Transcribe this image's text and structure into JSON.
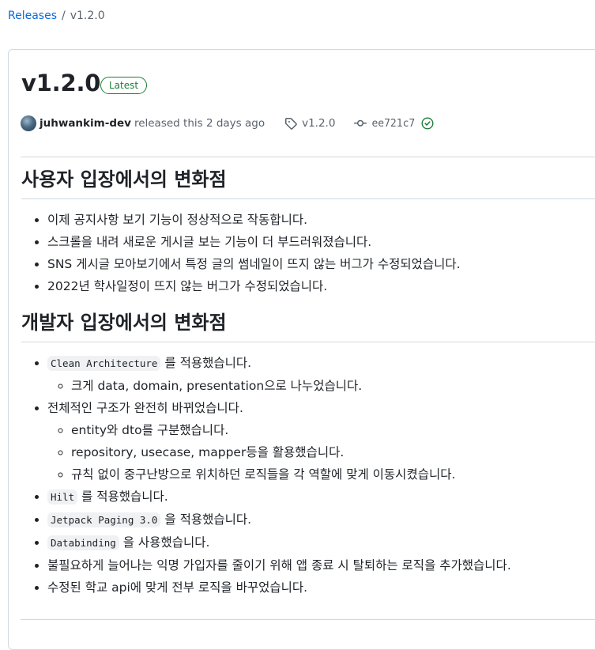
{
  "breadcrumb": {
    "root": "Releases",
    "sep": "/",
    "current": "v1.2.0"
  },
  "release": {
    "title": "v1.2.0",
    "badge": "Latest",
    "author": "juhwankim-dev",
    "released_text": "released this 2 days ago",
    "tag": "v1.2.0",
    "commit": "ee721c7"
  },
  "sections": [
    {
      "heading": "사용자 입장에서의 변화점",
      "items": [
        "이제 공지사항 보기 기능이 정상적으로 작동합니다.",
        "스크롤을 내려 새로운 게시글 보는 기능이 더 부드러워졌습니다.",
        "SNS 게시글 모아보기에서 특정 글의 썸네일이 뜨지 않는 버그가 수정되었습니다.",
        "2022년 학사일정이 뜨지 않는 버그가 수정되었습니다."
      ]
    },
    {
      "heading": "개발자 입장에서의 변화점",
      "items": [
        {
          "code": "Clean Architecture",
          "text": "를 적용했습니다."
        },
        {
          "sub": "크게 data, domain, presentation으로 나누었습니다."
        },
        {
          "text": "전체적인 구조가 완전히 바뀌었습니다."
        },
        {
          "sub": "entity와 dto를 구분했습니다."
        },
        {
          "sub": "repository, usecase, mapper등을 활용했습니다."
        },
        {
          "sub": "규칙 없이 중구난방으로 위치하던 로직들을 각 역할에 맞게 이동시켰습니다."
        },
        {
          "code": "Hilt",
          "text": "를 적용했습니다."
        },
        {
          "code": "Jetpack Paging 3.0",
          "text": "을 적용했습니다."
        },
        {
          "code": "Databinding",
          "text": "을 사용했습니다."
        },
        {
          "text": "불필요하게 늘어나는 익명 가입자를 줄이기 위해 앱 종료 시 탈퇴하는 로직을 추가했습니다."
        },
        {
          "text": "수정된 학교 api에 맞게 전부 로직을 바꾸었습니다."
        }
      ]
    }
  ],
  "colors": {
    "link": "#0969da",
    "success": "#1a7f37",
    "border": "#d1d9e0",
    "muted": "#59636e"
  },
  "icons": {
    "tag": "tag-icon",
    "commit": "commit-icon",
    "verified": "check-circle-icon"
  }
}
